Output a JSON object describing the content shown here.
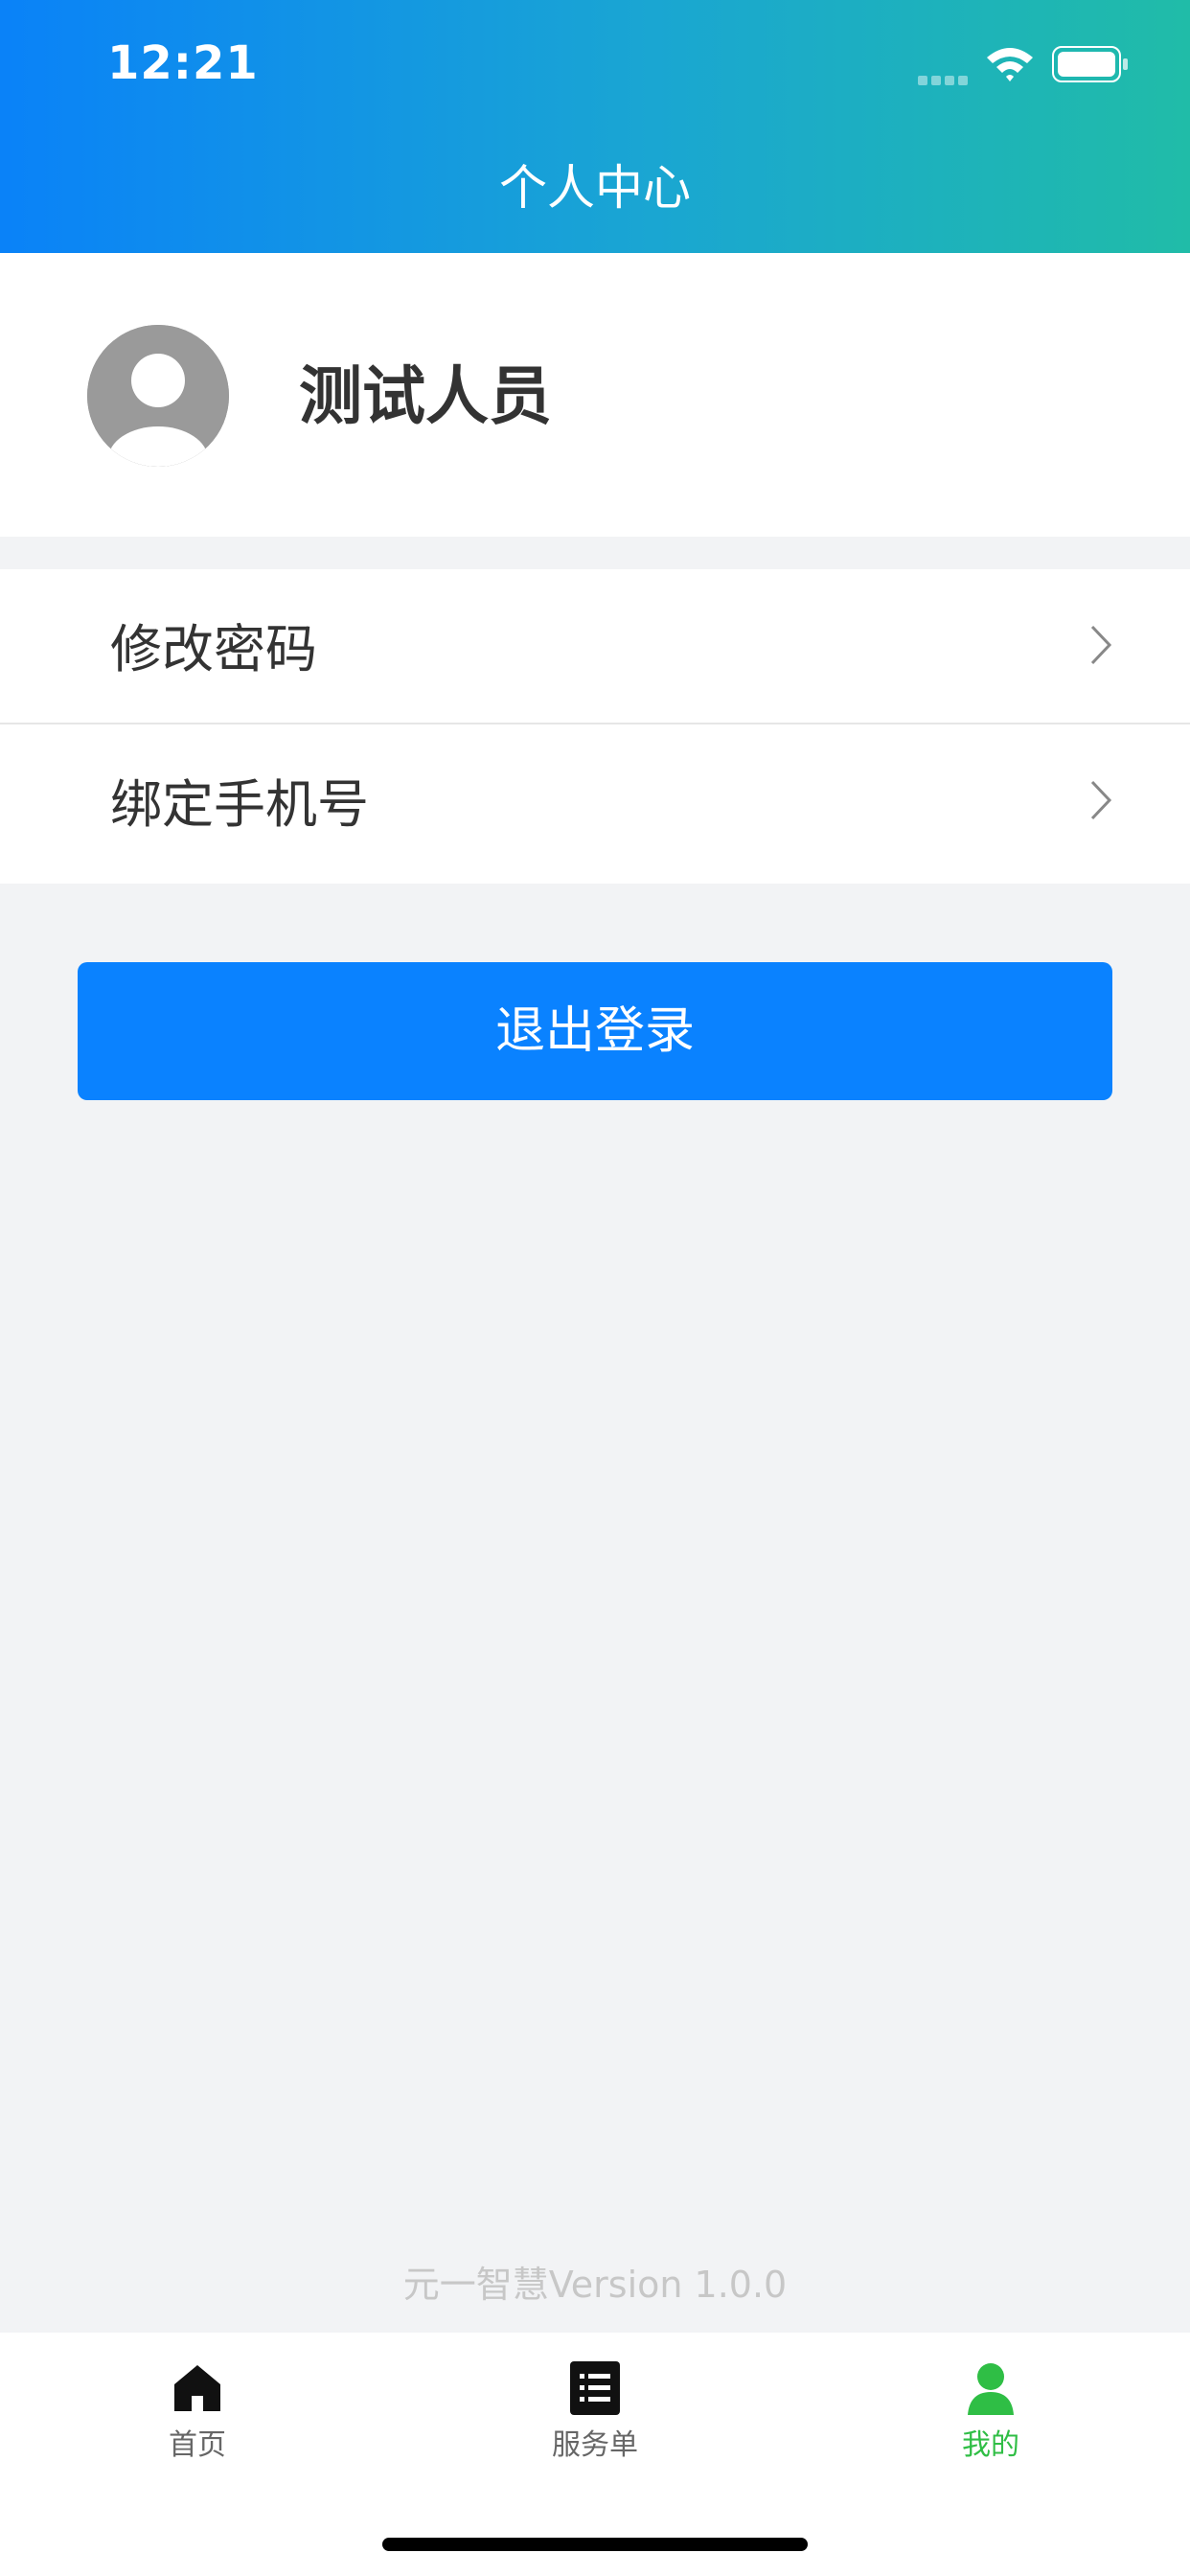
{
  "status_bar": {
    "time": "12:21"
  },
  "header": {
    "title": "个人中心"
  },
  "profile": {
    "name": "测试人员"
  },
  "menu": {
    "items": [
      {
        "label": "修改密码"
      },
      {
        "label": "绑定手机号"
      }
    ]
  },
  "logout": {
    "label": "退出登录"
  },
  "footer": {
    "version": "元一智慧Version  1.0.0"
  },
  "tabbar": {
    "items": [
      {
        "label": "首页",
        "icon": "home-icon"
      },
      {
        "label": "服务单",
        "icon": "list-icon"
      },
      {
        "label": "我的",
        "icon": "user-icon"
      }
    ],
    "active_index": 2
  },
  "colors": {
    "header_gradient_start": "#0a82f8",
    "header_gradient_end": "#20bca8",
    "accent": "#0a82ff",
    "tab_active": "#2fbe45",
    "page_background": "#f2f3f5"
  }
}
